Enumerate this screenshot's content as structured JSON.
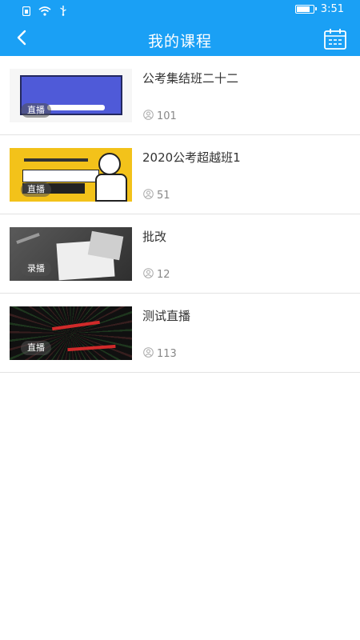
{
  "status_bar": {
    "time": "3:51",
    "battery_level": 0.85,
    "icons": [
      "sim-icon",
      "wifi-icon",
      "usb-icon",
      "battery-icon"
    ]
  },
  "header": {
    "title": "我的课程",
    "back_icon": "chevron-left-icon",
    "calendar_icon": "calendar-icon",
    "background_color": "#1aa0f5"
  },
  "courses": [
    {
      "title": "公考集结班二十二",
      "badge": "直播",
      "viewers": "101"
    },
    {
      "title": "2020公考超越班1",
      "badge": "直播",
      "viewers": "51"
    },
    {
      "title": "批改",
      "badge": "录播",
      "viewers": "12"
    },
    {
      "title": "测试直播",
      "badge": "直播",
      "viewers": "113"
    }
  ]
}
